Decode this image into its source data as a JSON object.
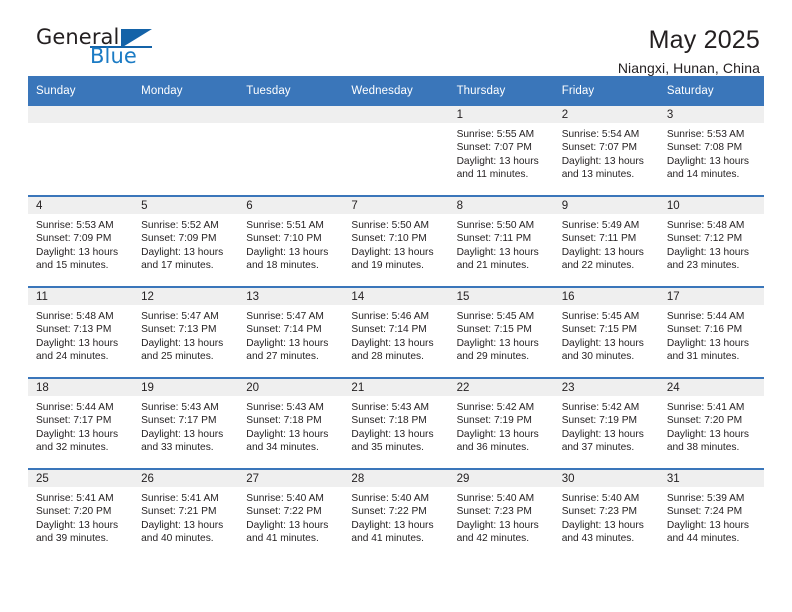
{
  "brand": {
    "name_part1": "General",
    "name_part2": "Blue",
    "logo_icon": "triangle-logo-icon",
    "accent_color": "#1463a8"
  },
  "header": {
    "title": "May 2025",
    "subtitle": "Niangxi, Hunan, China"
  },
  "theme": {
    "header_blue": "#3a76ba",
    "daynum_gray": "#efefef",
    "text": "#231f20"
  },
  "calendar": {
    "weekday_headers": [
      "Sunday",
      "Monday",
      "Tuesday",
      "Wednesday",
      "Thursday",
      "Friday",
      "Saturday"
    ],
    "labels": {
      "sunrise": "Sunrise:",
      "sunset": "Sunset:",
      "daylight": "Daylight:"
    },
    "weeks": [
      [
        {
          "day": "",
          "empty": true
        },
        {
          "day": "",
          "empty": true
        },
        {
          "day": "",
          "empty": true
        },
        {
          "day": "",
          "empty": true
        },
        {
          "day": "1",
          "sunrise": "Sunrise: 5:55 AM",
          "sunset": "Sunset: 7:07 PM",
          "daylight": "Daylight: 13 hours and 11 minutes."
        },
        {
          "day": "2",
          "sunrise": "Sunrise: 5:54 AM",
          "sunset": "Sunset: 7:07 PM",
          "daylight": "Daylight: 13 hours and 13 minutes."
        },
        {
          "day": "3",
          "sunrise": "Sunrise: 5:53 AM",
          "sunset": "Sunset: 7:08 PM",
          "daylight": "Daylight: 13 hours and 14 minutes."
        }
      ],
      [
        {
          "day": "4",
          "sunrise": "Sunrise: 5:53 AM",
          "sunset": "Sunset: 7:09 PM",
          "daylight": "Daylight: 13 hours and 15 minutes."
        },
        {
          "day": "5",
          "sunrise": "Sunrise: 5:52 AM",
          "sunset": "Sunset: 7:09 PM",
          "daylight": "Daylight: 13 hours and 17 minutes."
        },
        {
          "day": "6",
          "sunrise": "Sunrise: 5:51 AM",
          "sunset": "Sunset: 7:10 PM",
          "daylight": "Daylight: 13 hours and 18 minutes."
        },
        {
          "day": "7",
          "sunrise": "Sunrise: 5:50 AM",
          "sunset": "Sunset: 7:10 PM",
          "daylight": "Daylight: 13 hours and 19 minutes."
        },
        {
          "day": "8",
          "sunrise": "Sunrise: 5:50 AM",
          "sunset": "Sunset: 7:11 PM",
          "daylight": "Daylight: 13 hours and 21 minutes."
        },
        {
          "day": "9",
          "sunrise": "Sunrise: 5:49 AM",
          "sunset": "Sunset: 7:11 PM",
          "daylight": "Daylight: 13 hours and 22 minutes."
        },
        {
          "day": "10",
          "sunrise": "Sunrise: 5:48 AM",
          "sunset": "Sunset: 7:12 PM",
          "daylight": "Daylight: 13 hours and 23 minutes."
        }
      ],
      [
        {
          "day": "11",
          "sunrise": "Sunrise: 5:48 AM",
          "sunset": "Sunset: 7:13 PM",
          "daylight": "Daylight: 13 hours and 24 minutes."
        },
        {
          "day": "12",
          "sunrise": "Sunrise: 5:47 AM",
          "sunset": "Sunset: 7:13 PM",
          "daylight": "Daylight: 13 hours and 25 minutes."
        },
        {
          "day": "13",
          "sunrise": "Sunrise: 5:47 AM",
          "sunset": "Sunset: 7:14 PM",
          "daylight": "Daylight: 13 hours and 27 minutes."
        },
        {
          "day": "14",
          "sunrise": "Sunrise: 5:46 AM",
          "sunset": "Sunset: 7:14 PM",
          "daylight": "Daylight: 13 hours and 28 minutes."
        },
        {
          "day": "15",
          "sunrise": "Sunrise: 5:45 AM",
          "sunset": "Sunset: 7:15 PM",
          "daylight": "Daylight: 13 hours and 29 minutes."
        },
        {
          "day": "16",
          "sunrise": "Sunrise: 5:45 AM",
          "sunset": "Sunset: 7:15 PM",
          "daylight": "Daylight: 13 hours and 30 minutes."
        },
        {
          "day": "17",
          "sunrise": "Sunrise: 5:44 AM",
          "sunset": "Sunset: 7:16 PM",
          "daylight": "Daylight: 13 hours and 31 minutes."
        }
      ],
      [
        {
          "day": "18",
          "sunrise": "Sunrise: 5:44 AM",
          "sunset": "Sunset: 7:17 PM",
          "daylight": "Daylight: 13 hours and 32 minutes."
        },
        {
          "day": "19",
          "sunrise": "Sunrise: 5:43 AM",
          "sunset": "Sunset: 7:17 PM",
          "daylight": "Daylight: 13 hours and 33 minutes."
        },
        {
          "day": "20",
          "sunrise": "Sunrise: 5:43 AM",
          "sunset": "Sunset: 7:18 PM",
          "daylight": "Daylight: 13 hours and 34 minutes."
        },
        {
          "day": "21",
          "sunrise": "Sunrise: 5:43 AM",
          "sunset": "Sunset: 7:18 PM",
          "daylight": "Daylight: 13 hours and 35 minutes."
        },
        {
          "day": "22",
          "sunrise": "Sunrise: 5:42 AM",
          "sunset": "Sunset: 7:19 PM",
          "daylight": "Daylight: 13 hours and 36 minutes."
        },
        {
          "day": "23",
          "sunrise": "Sunrise: 5:42 AM",
          "sunset": "Sunset: 7:19 PM",
          "daylight": "Daylight: 13 hours and 37 minutes."
        },
        {
          "day": "24",
          "sunrise": "Sunrise: 5:41 AM",
          "sunset": "Sunset: 7:20 PM",
          "daylight": "Daylight: 13 hours and 38 minutes."
        }
      ],
      [
        {
          "day": "25",
          "sunrise": "Sunrise: 5:41 AM",
          "sunset": "Sunset: 7:20 PM",
          "daylight": "Daylight: 13 hours and 39 minutes."
        },
        {
          "day": "26",
          "sunrise": "Sunrise: 5:41 AM",
          "sunset": "Sunset: 7:21 PM",
          "daylight": "Daylight: 13 hours and 40 minutes."
        },
        {
          "day": "27",
          "sunrise": "Sunrise: 5:40 AM",
          "sunset": "Sunset: 7:22 PM",
          "daylight": "Daylight: 13 hours and 41 minutes."
        },
        {
          "day": "28",
          "sunrise": "Sunrise: 5:40 AM",
          "sunset": "Sunset: 7:22 PM",
          "daylight": "Daylight: 13 hours and 41 minutes."
        },
        {
          "day": "29",
          "sunrise": "Sunrise: 5:40 AM",
          "sunset": "Sunset: 7:23 PM",
          "daylight": "Daylight: 13 hours and 42 minutes."
        },
        {
          "day": "30",
          "sunrise": "Sunrise: 5:40 AM",
          "sunset": "Sunset: 7:23 PM",
          "daylight": "Daylight: 13 hours and 43 minutes."
        },
        {
          "day": "31",
          "sunrise": "Sunrise: 5:39 AM",
          "sunset": "Sunset: 7:24 PM",
          "daylight": "Daylight: 13 hours and 44 minutes."
        }
      ]
    ]
  }
}
